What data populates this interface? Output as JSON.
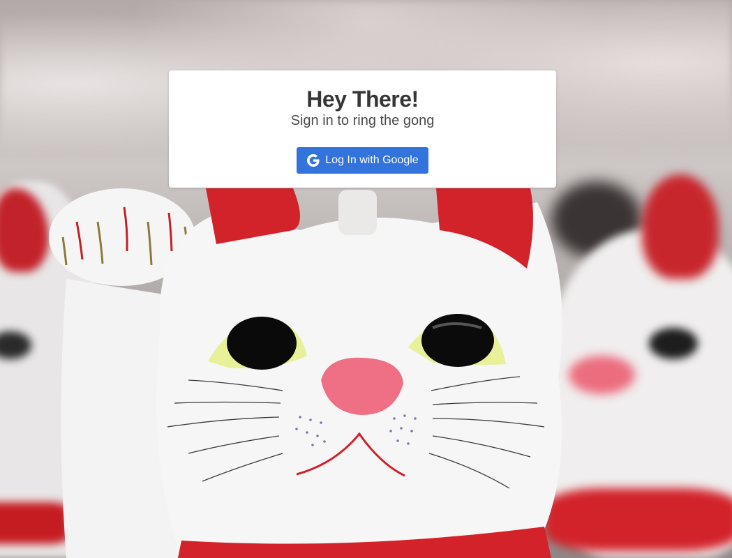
{
  "card": {
    "title": "Hey There!",
    "subtitle": "Sign in to ring the gong",
    "login_button_label": "Log In with Google",
    "login_button_icon": "google-icon",
    "login_button_color": "#3273dc"
  },
  "background": {
    "image": "maneki-neko-cats-photo"
  }
}
